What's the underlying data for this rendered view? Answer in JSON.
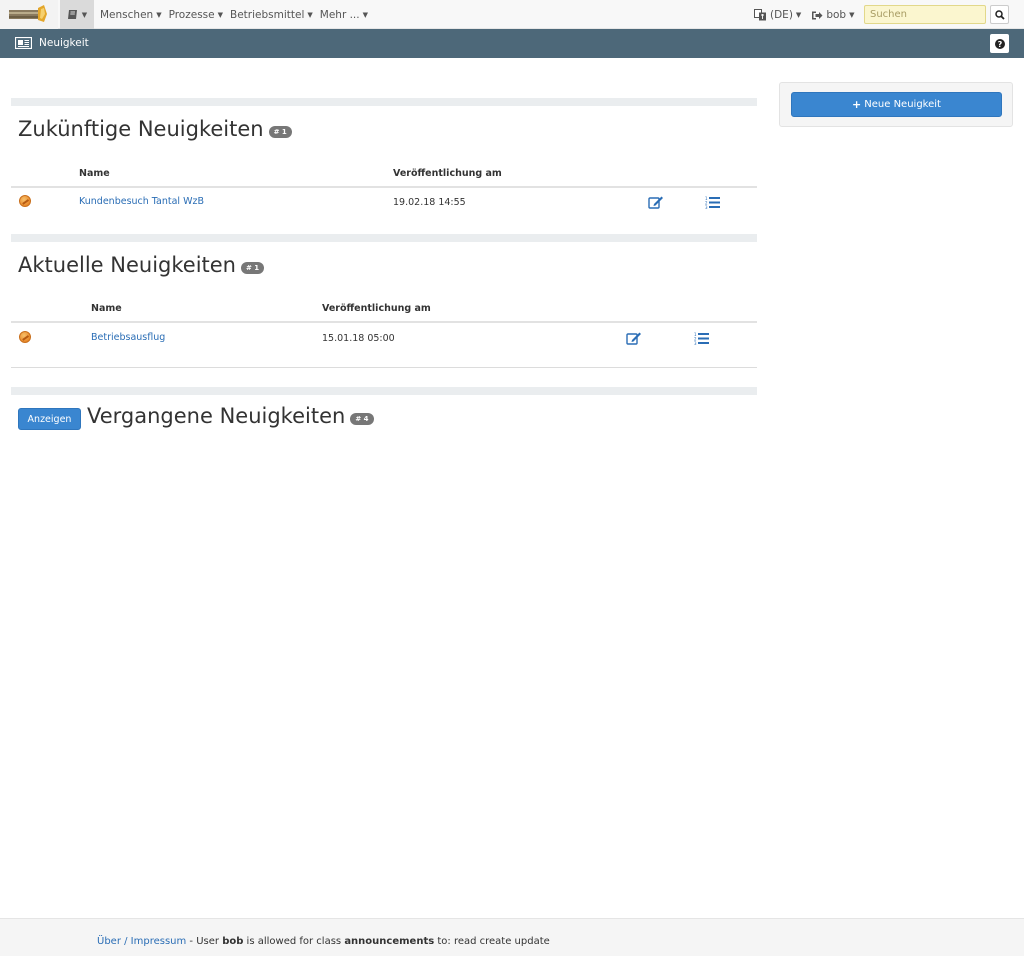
{
  "topbar": {
    "logo_icon": "app-logo",
    "book_icon": "book-icon",
    "menu": [
      {
        "label": "Menschen"
      },
      {
        "label": "Prozesse"
      },
      {
        "label": "Betriebsmittel"
      },
      {
        "label": "Mehr ..."
      }
    ],
    "language_label": "(DE)",
    "user_label": "bob",
    "search_placeholder": "Suchen"
  },
  "subbar": {
    "title": "Neuigkeit"
  },
  "sidebar": {
    "new_button_label": "Neue Neuigkeit"
  },
  "sections": {
    "upcoming": {
      "title": "Zukünftige Neuigkeiten",
      "count": "# 1",
      "col_name": "Name",
      "col_published": "Veröffentlichung am",
      "rows": [
        {
          "name": "Kundenbesuch Tantal WzB",
          "published": "19.02.18 14:55"
        }
      ]
    },
    "current": {
      "title": "Aktuelle Neuigkeiten",
      "count": "# 1",
      "col_name": "Name",
      "col_published": "Veröffentlichung am",
      "rows": [
        {
          "name": "Betriebsausflug",
          "published": "15.01.18 05:00"
        }
      ]
    },
    "past": {
      "show_button": "Anzeigen",
      "title": "Vergangene Neuigkeiten",
      "count": "# 4"
    }
  },
  "footer": {
    "about_link": "Über / Impressum",
    "text_user": " - User ",
    "user": "bob",
    "text_allowed": " is allowed for class ",
    "class_name": "announcements",
    "text_permissions": " to: read create update"
  },
  "colors": {
    "accent": "#3a86d0",
    "subbar": "#4d6879",
    "link": "#2a6db5"
  }
}
